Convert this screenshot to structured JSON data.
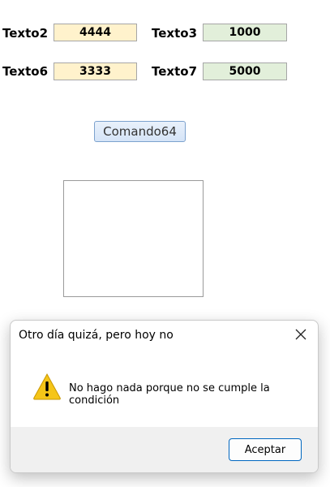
{
  "form": {
    "rows": [
      {
        "label_a": "Texto2",
        "value_a": "4444",
        "label_b": "Texto3",
        "value_b": "1000"
      },
      {
        "label_a": "Texto6",
        "value_a": "3333",
        "label_b": "Texto7",
        "value_b": "5000"
      }
    ],
    "command_button": "Comando64",
    "field_colors": {
      "yellow": "#fff2cc",
      "green": "#e2efda"
    }
  },
  "dialog": {
    "title": "Otro día quizá, pero hoy no",
    "message": "No hago nada porque no se cumple la condición",
    "ok_label": "Aceptar",
    "icon": "warning-icon",
    "close_icon": "close-icon"
  }
}
